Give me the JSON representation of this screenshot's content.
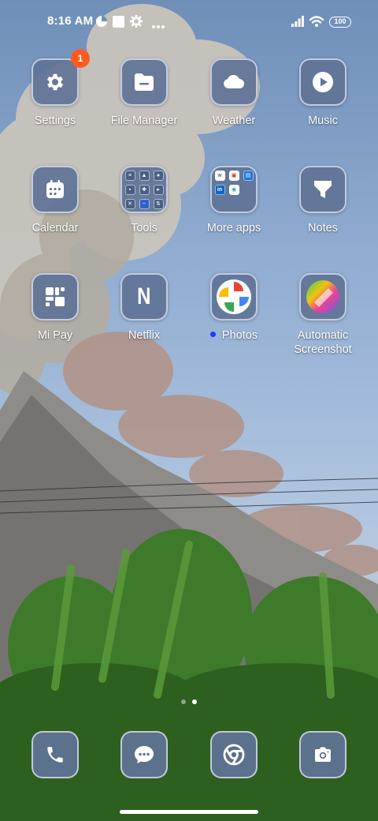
{
  "status_bar": {
    "time": "8:16 AM",
    "battery": "100",
    "icons": [
      "app-notification-icon",
      "square-notification-icon",
      "gear-icon",
      "more-dots-icon",
      "signal-icon",
      "wifi-icon",
      "battery-icon"
    ]
  },
  "apps": [
    {
      "label": "Settings",
      "icon": "gear-icon",
      "badge": "1"
    },
    {
      "label": "File Manager",
      "icon": "folder-icon"
    },
    {
      "label": "Weather",
      "icon": "cloud-icon"
    },
    {
      "label": "Music",
      "icon": "play-icon"
    },
    {
      "label": "Calendar",
      "icon": "calendar-icon"
    },
    {
      "label": "Tools",
      "icon": "folder-tools"
    },
    {
      "label": "More apps",
      "icon": "folder-more-apps"
    },
    {
      "label": "Notes",
      "icon": "notes-icon"
    },
    {
      "label": "Mi Pay",
      "icon": "mi-pay-icon"
    },
    {
      "label": "Netflix",
      "icon": "netflix-icon",
      "glyph": "N"
    },
    {
      "label": "Photos",
      "icon": "photos-pinwheel-icon",
      "new_indicator": true
    },
    {
      "label": "Automatic\nScreenshot",
      "icon": "screenshot-icon"
    }
  ],
  "dock": [
    {
      "icon": "phone-icon"
    },
    {
      "icon": "messages-icon"
    },
    {
      "icon": "chrome-icon"
    },
    {
      "icon": "camera-icon"
    }
  ],
  "page_indicator": {
    "pages": 2,
    "active": 2
  },
  "colors": {
    "badge": "#ff5a1f",
    "tile": "#5f7396",
    "new_dot": "#1c3cff"
  }
}
